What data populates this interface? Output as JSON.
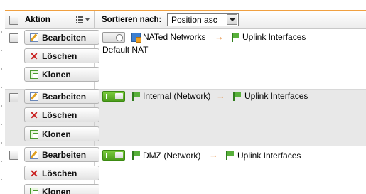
{
  "header": {
    "action_label": "Aktion",
    "sort_label": "Sortieren nach:",
    "sort_value": "Position asc"
  },
  "buttons": {
    "edit": "Bearbeiten",
    "delete": "Löschen",
    "clone": "Klonen"
  },
  "rules": [
    {
      "enabled": false,
      "source": "NATed Networks",
      "destination": "Uplink Interfaces",
      "comment": "Default NAT"
    },
    {
      "enabled": true,
      "source": "Internal (Network)",
      "destination": "Uplink Interfaces",
      "comment": ""
    },
    {
      "enabled": true,
      "source": "DMZ (Network)",
      "destination": "Uplink Interfaces",
      "comment": ""
    }
  ],
  "colors": {
    "accent_border": "#f0a040",
    "toggle_on": "#5cb02a",
    "arrow": "#e07818",
    "alt_row": "#e8e8e8"
  },
  "icons": {
    "nat_network": "nat-network-icon",
    "network": "network-flag-icon",
    "interface": "interface-flag-icon",
    "arrow": "arrow-right-icon"
  }
}
